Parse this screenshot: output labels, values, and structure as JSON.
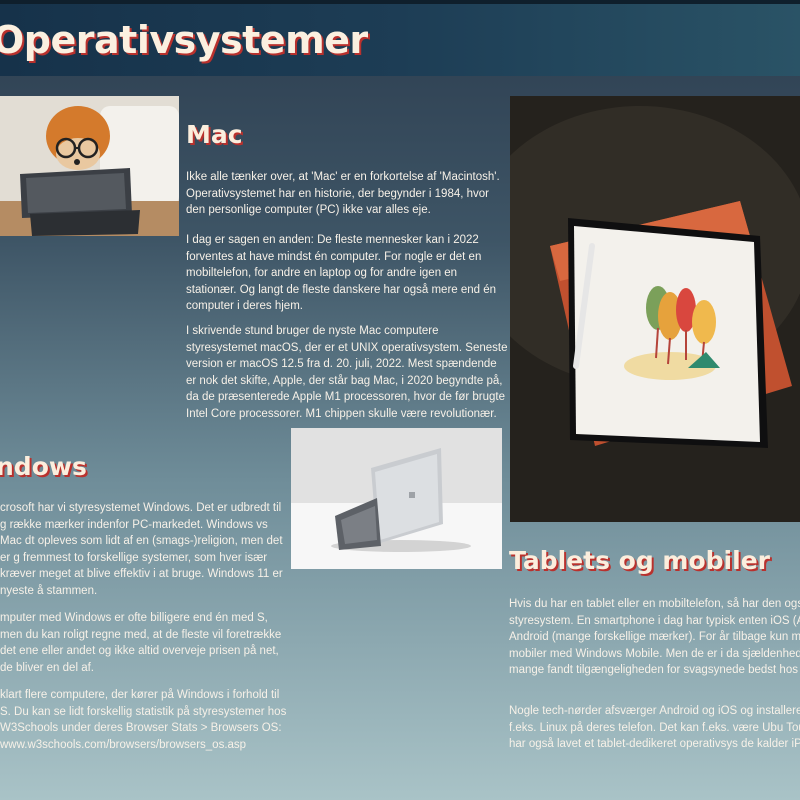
{
  "page": {
    "title": "Operativsystemer"
  },
  "mac": {
    "heading": "Mac",
    "paragraphs": [
      "Ikke alle tænker over, at 'Mac' er en forkortelse af 'Macintosh'. Operativsystemet har en historie, der begynder i 1984, hvor den personlige computer (PC) ikke var alles eje.",
      "I dag er sagen en anden: De fleste mennesker kan i 2022 forventes at have mindst én computer. For nogle er det en mobiltelefon, for andre en laptop og for andre igen en stationær. Og langt de fleste danskere har også mere end én computer i deres hjem.",
      "I skrivende stund bruger de nyste Mac computere styresystemet macOS, der er et UNIX operativsystem. Seneste version er macOS 12.5 fra d. 20. juli, 2022. Mest spændende er nok det skifte, Apple, der står bag Mac, i 2020 begyndte på, da de præsenterede Apple M1 processoren, hvor de før brugte Intel Core processorer. M1 chippen skulle være revolutionær."
    ]
  },
  "windows": {
    "heading": "ndows",
    "paragraphs": [
      "crosoft har vi styresystemet Windows. Det er udbredt til g række mærker indenfor PC-markedet. Windows vs Mac dt opleves som lidt af en (smags-)religion, men det er g fremmest to forskellige systemer, som hver især kræver meget at blive effektiv i at bruge. Windows 11 er nyeste å stammen.",
      "mputer med Windows er ofte billigere end én med S, men du kan roligt regne med, at de fleste vil foretrække det ene eller andet og ikke altid overveje prisen på net, de bliver en del af.",
      "klart flere computere, der kører på Windows i forhold til S. Du kan se lidt forskellig statistik på styresystemer hos W3Schools under deres Browser Stats > Browsers OS: www.w3schools.com/browsers/browsers_os.asp"
    ]
  },
  "tablets": {
    "heading": "Tablets og mobiler",
    "paragraphs": [
      "Hvis du har en tablet eller en mobiltelefon, så har den også styresystem. En smartphone i dag har typisk enten iOS (Ap eller Android (mange forskellige mærker). For år tilbage kun man også se mobiler med Windows Mobile. Men de er i da sjældenhed, selvom mange fandt tilgængeligheden for svagsynede bedst hos Windows.",
      "Nogle tech-nørder afsværger Android og iOS og installerer stedet f.eks. Linux på deres telefon. Det kan f.eks. være Ubu Touch. Apple har også lavet et tablet-dedikeret operativsys de kalder iPadOS."
    ]
  },
  "colors": {
    "heading_shadow": "#b9312d",
    "heading_text": "#fbeedd",
    "topbar": "#1d3d55"
  }
}
